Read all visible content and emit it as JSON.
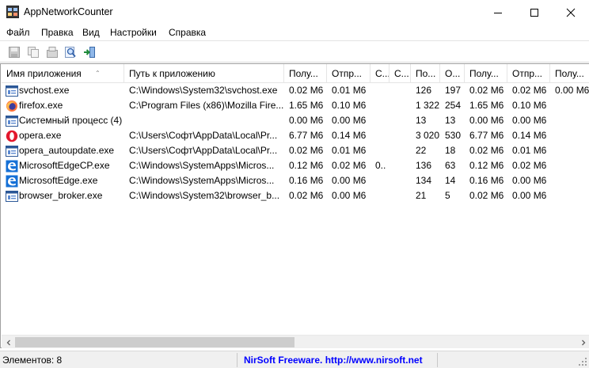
{
  "window": {
    "title": "AppNetworkCounter",
    "minimize_icon": "minimize-icon",
    "maximize_icon": "maximize-icon",
    "close_icon": "close-icon"
  },
  "menu": {
    "items": [
      {
        "label": "Файл"
      },
      {
        "label": "Правка"
      },
      {
        "label": "Вид"
      },
      {
        "label": "Настройки"
      },
      {
        "label": "Справка"
      }
    ]
  },
  "toolbar": {
    "buttons": [
      {
        "icon": "save-icon"
      },
      {
        "icon": "copy-icon"
      },
      {
        "icon": "properties-icon"
      },
      {
        "icon": "find-icon"
      },
      {
        "icon": "exit-icon"
      }
    ]
  },
  "table": {
    "columns": [
      {
        "label": "Имя приложения"
      },
      {
        "label": "Путь к приложению"
      },
      {
        "label": "Полу..."
      },
      {
        "label": "Отпр..."
      },
      {
        "label": "С..."
      },
      {
        "label": "С..."
      },
      {
        "label": "По..."
      },
      {
        "label": "О..."
      },
      {
        "label": "Полу..."
      },
      {
        "label": "Отпр..."
      },
      {
        "label": "Полу..."
      }
    ],
    "rows": [
      {
        "icon": "app-window-icon",
        "cells": [
          "svchost.exe",
          "C:\\Windows\\System32\\svchost.exe",
          "0.02 M6",
          "0.01 M6",
          "",
          "",
          "126",
          "197",
          "0.02 M6",
          "0.02 M6",
          "0.00 M6"
        ]
      },
      {
        "icon": "firefox-icon",
        "cells": [
          "firefox.exe",
          "C:\\Program Files (x86)\\Mozilla Fire...",
          "1.65 M6",
          "0.10 M6",
          "",
          "",
          "1 322",
          "254",
          "1.65 M6",
          "0.10 M6",
          ""
        ]
      },
      {
        "icon": "app-window-icon",
        "cells": [
          "Системный процесс (4)",
          "",
          "0.00 M6",
          "0.00 M6",
          "",
          "",
          "13",
          "13",
          "0.00 M6",
          "0.00 M6",
          ""
        ]
      },
      {
        "icon": "opera-icon",
        "cells": [
          "opera.exe",
          "C:\\Users\\Софт\\AppData\\Local\\Pr...",
          "6.77 M6",
          "0.14 M6",
          "",
          "",
          "3 020",
          "530",
          "6.77 M6",
          "0.14 M6",
          ""
        ]
      },
      {
        "icon": "app-window-icon",
        "cells": [
          "opera_autoupdate.exe",
          "C:\\Users\\Софт\\AppData\\Local\\Pr...",
          "0.02 M6",
          "0.01 M6",
          "",
          "",
          "22",
          "18",
          "0.02 M6",
          "0.01 M6",
          ""
        ]
      },
      {
        "icon": "edge-icon",
        "cells": [
          "MicrosoftEdgeCP.exe",
          "C:\\Windows\\SystemApps\\Micros...",
          "0.12 M6",
          "0.02 M6",
          "0..",
          "",
          "136",
          "63",
          "0.12 M6",
          "0.02 M6",
          ""
        ]
      },
      {
        "icon": "edge-icon",
        "cells": [
          "MicrosoftEdge.exe",
          "C:\\Windows\\SystemApps\\Micros...",
          "0.16 M6",
          "0.00 M6",
          "",
          "",
          "134",
          "14",
          "0.16 M6",
          "0.00 M6",
          ""
        ]
      },
      {
        "icon": "app-window-icon",
        "cells": [
          "browser_broker.exe",
          "C:\\Windows\\System32\\browser_b...",
          "0.02 M6",
          "0.00 M6",
          "",
          "",
          "21",
          "5",
          "0.02 M6",
          "0.00 M6",
          ""
        ]
      }
    ]
  },
  "status": {
    "count": "Элементов: 8",
    "link": "NirSoft Freeware.  http://www.nirsoft.net"
  }
}
